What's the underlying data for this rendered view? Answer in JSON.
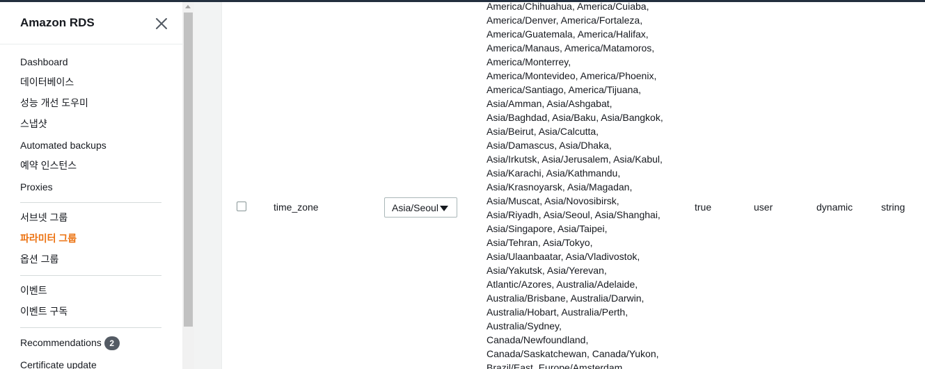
{
  "sidebar": {
    "title": "Amazon RDS",
    "close_icon": "close-icon",
    "groups": [
      [
        {
          "label": "Dashboard",
          "active": false
        },
        {
          "label": "데이터베이스",
          "active": false
        },
        {
          "label": "성능 개선 도우미",
          "active": false
        },
        {
          "label": "스냅샷",
          "active": false
        },
        {
          "label": "Automated backups",
          "active": false
        },
        {
          "label": "예약 인스턴스",
          "active": false
        },
        {
          "label": "Proxies",
          "active": false
        }
      ],
      [
        {
          "label": "서브넷 그룹",
          "active": false
        },
        {
          "label": "파라미터 그룹",
          "active": true
        },
        {
          "label": "옵션 그룹",
          "active": false
        }
      ],
      [
        {
          "label": "이벤트",
          "active": false
        },
        {
          "label": "이벤트 구독",
          "active": false
        }
      ],
      [
        {
          "label": "Recommendations",
          "active": false,
          "badge": "2"
        },
        {
          "label": "Certificate update",
          "active": false
        }
      ]
    ]
  },
  "parameter_row": {
    "name": "time_zone",
    "value": "Asia/Seoul",
    "modifiable": "true",
    "source": "user",
    "apply_type": "dynamic",
    "data_type": "string",
    "allowed_values": [
      "America/Chihuahua, America/Cuiaba,",
      "America/Denver, America/Fortaleza,",
      "America/Guatemala, America/Halifax,",
      "America/Manaus, America/Matamoros,",
      "America/Monterrey,",
      "America/Montevideo, America/Phoenix,",
      "America/Santiago, America/Tijuana,",
      "Asia/Amman, Asia/Ashgabat,",
      "Asia/Baghdad, Asia/Baku, Asia/Bangkok,",
      "Asia/Beirut, Asia/Calcutta,",
      "Asia/Damascus, Asia/Dhaka,",
      "Asia/Irkutsk, Asia/Jerusalem, Asia/Kabul,",
      "Asia/Karachi, Asia/Kathmandu,",
      "Asia/Krasnoyarsk, Asia/Magadan,",
      "Asia/Muscat, Asia/Novosibirsk,",
      "Asia/Riyadh, Asia/Seoul, Asia/Shanghai,",
      "Asia/Singapore, Asia/Taipei,",
      "Asia/Tehran, Asia/Tokyo,",
      "Asia/Ulaanbaatar, Asia/Vladivostok,",
      "Asia/Yakutsk, Asia/Yerevan,",
      "Atlantic/Azores, Australia/Adelaide,",
      "Australia/Brisbane, Australia/Darwin,",
      "Australia/Hobart, Australia/Perth,",
      "Australia/Sydney,",
      "Canada/Newfoundland,",
      "Canada/Saskatchewan, Canada/Yukon,",
      "Brazil/East, Europe/Amsterdam,"
    ]
  },
  "colors": {
    "active_nav": "#ec7211",
    "badge_bg": "#545b64",
    "top_bar": "#232f3e"
  }
}
